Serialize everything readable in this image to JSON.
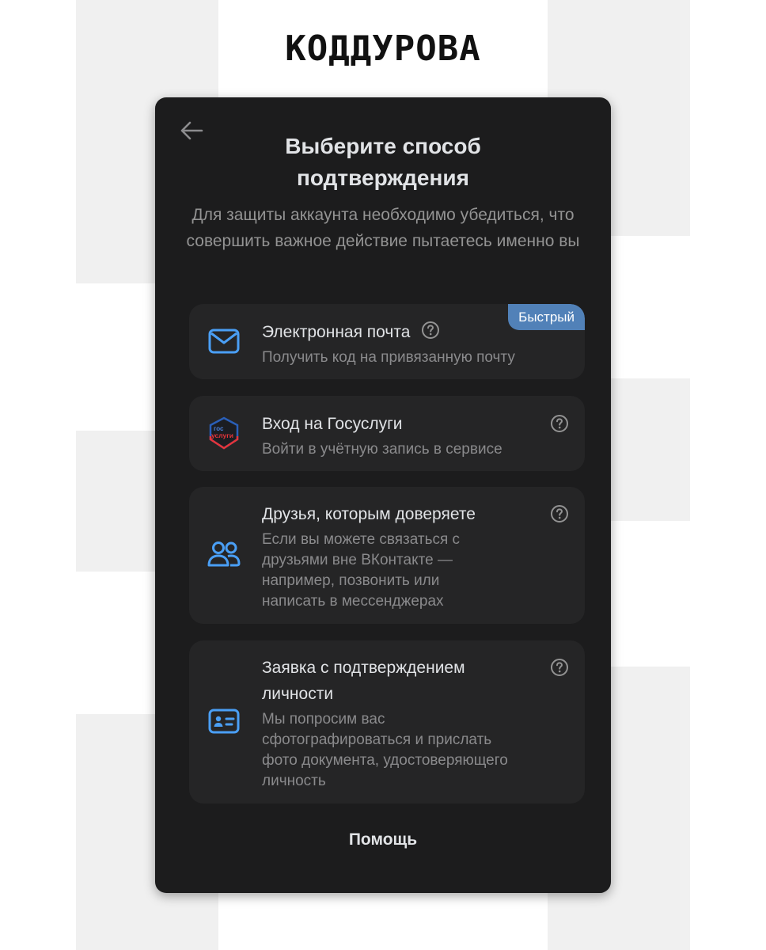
{
  "brand": {
    "name": "КОДДУРОВА"
  },
  "modal": {
    "title": "Выберите способ подтверждения",
    "subtitle": "Для защиты аккаунта необходимо убедиться, что совершить важное действие пытаетесь именно вы",
    "help_link": "Помощь"
  },
  "methods": [
    {
      "icon": "mail-icon",
      "title": "Электронная почта",
      "description": "Получить код на привязанную почту",
      "badge": "Быстрый"
    },
    {
      "icon": "gosuslugi-logo",
      "logo_text_top": "гос",
      "logo_text_bottom": "услуги",
      "title": "Вход на Госуслуги",
      "description": "Войти в учётную запись в сервисе"
    },
    {
      "icon": "users-icon",
      "title": "Друзья, которым доверяете",
      "description": "Если вы можете связаться с друзьями вне ВКонтакте — например, позвонить или написать в мессенджерах"
    },
    {
      "icon": "id-card-icon",
      "title": "Заявка с подтверждением личности",
      "description": "Мы попросим вас сфотографироваться и прислать фото документа, удостоверяющего личность"
    }
  ],
  "colors": {
    "modal_bg": "#1c1c1d",
    "card_bg": "#252526",
    "accent": "#5181b8",
    "icon_blue": "#4a9ff5"
  }
}
